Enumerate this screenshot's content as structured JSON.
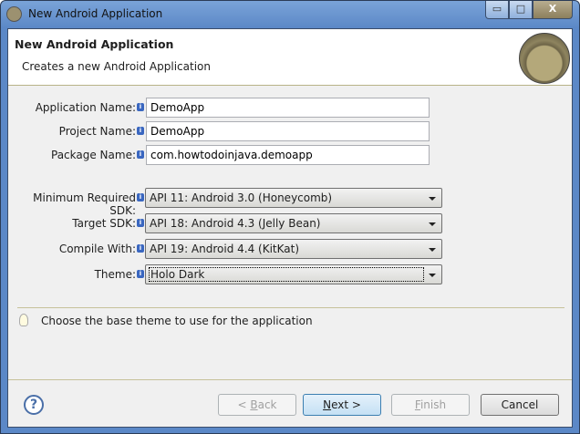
{
  "window": {
    "title": "New Android Application",
    "minimize": "▭",
    "maximize": "□",
    "close": "X"
  },
  "header": {
    "title": "New Android Application",
    "subtitle": "Creates a new Android Application"
  },
  "form": {
    "app_name": {
      "label": "Application Name:",
      "value": "DemoApp"
    },
    "project_name": {
      "label": "Project Name:",
      "value": "DemoApp"
    },
    "package_name": {
      "label": "Package Name:",
      "value": "com.howtodoinjava.demoapp"
    },
    "min_sdk": {
      "label": "Minimum Required SDK:",
      "value": "API 11: Android 3.0 (Honeycomb)"
    },
    "target_sdk": {
      "label": "Target SDK:",
      "value": "API 18: Android 4.3 (Jelly Bean)"
    },
    "compile_with": {
      "label": "Compile With:",
      "value": "API 19: Android 4.4 (KitKat)"
    },
    "theme": {
      "label": "Theme:",
      "value": "Holo Dark"
    }
  },
  "hint": "Choose the base theme to use for the application",
  "buttons": {
    "back_pre": "< ",
    "back_u": "B",
    "back_post": "ack",
    "next_u": "N",
    "next_post": "ext >",
    "finish_u": "F",
    "finish_post": "inish",
    "cancel": "Cancel",
    "help": "?"
  }
}
